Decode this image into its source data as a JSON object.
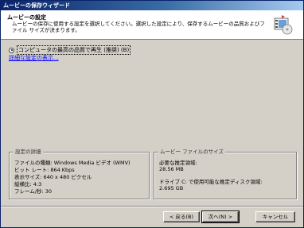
{
  "window": {
    "title": "ムービーの保存ウィザード"
  },
  "header": {
    "title": "ムービーの設定",
    "description": "ムービーの保存に使用する設定を選択してください。選択した設定により、保存するムービーの品質およびファイル サイズが決まります。",
    "icon": "movie-wizard-icon"
  },
  "option": {
    "label": "コンピュータの最高の品質で再生 (推奨) (B)",
    "selected": true
  },
  "link": {
    "label": "詳細な設定の表示..."
  },
  "details": {
    "legend": "設定の詳細",
    "lines": [
      "ファイルの種類: Windows Media ビデオ (WMV)",
      "ビット レート: 864 Kbps",
      "表示サイズ: 640 x 480 ピクセル",
      "縦横比: 4:3",
      "フレーム/秒: 30"
    ]
  },
  "filesize": {
    "legend": "ムービー ファイルのサイズ",
    "estimate_label": "必要な推定領域:",
    "estimate_value": "28.56 MB",
    "disk_label": "ドライブ C: で使用可能な推定ディスク領域:",
    "disk_value": "2.695 GB"
  },
  "buttons": {
    "back": "< 戻る(B)",
    "next": "次へ(N) >",
    "cancel": "キャンセル"
  }
}
